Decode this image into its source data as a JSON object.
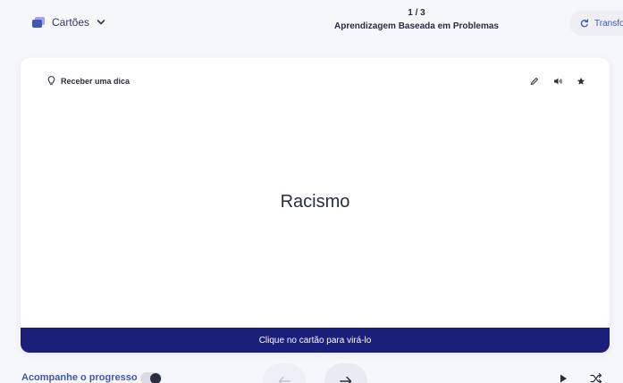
{
  "header": {
    "mode_label": "Cartões",
    "progress_count": "1 / 3",
    "set_title": "Aprendizagem Baseada em Problemas",
    "transform_label": "Transfo"
  },
  "card": {
    "hint_label": "Receber uma dica",
    "term": "Racismo",
    "flip_instruction": "Clique no cartão para virá-lo"
  },
  "footer": {
    "track_progress_label": "Acompanhe o progresso",
    "track_progress_on": false
  },
  "icons": {
    "mode": "cards-icon",
    "chevron": "chevron-down-icon",
    "transform": "refresh-icon",
    "hint": "lightbulb-icon",
    "edit": "pencil-icon",
    "audio": "speaker-icon",
    "star": "star-icon",
    "prev": "arrow-left-icon",
    "next": "arrow-right-icon",
    "play": "play-icon",
    "shuffle": "shuffle-icon"
  },
  "colors": {
    "accent": "#4257b2",
    "flip_bar": "#1c1f7a",
    "background": "#f6f7fb",
    "card": "#ffffff"
  }
}
